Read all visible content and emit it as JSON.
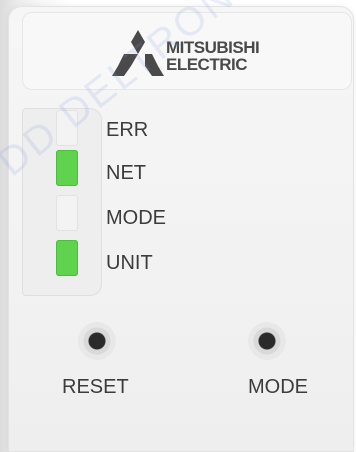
{
  "brand": {
    "line1": "MITSUBISHI",
    "line2": "ELECTRIC",
    "logo_icon": "mitsubishi-three-diamonds",
    "color": "#4a4a4a"
  },
  "leds": [
    {
      "label": "ERR",
      "lit": false
    },
    {
      "label": "NET",
      "lit": true,
      "color": "#5fd24e"
    },
    {
      "label": "MODE",
      "lit": false
    },
    {
      "label": "UNIT",
      "lit": true,
      "color": "#5fd24e"
    }
  ],
  "buttons": [
    {
      "label": "RESET"
    },
    {
      "label": "MODE"
    }
  ],
  "watermark": "DD DELTRON"
}
